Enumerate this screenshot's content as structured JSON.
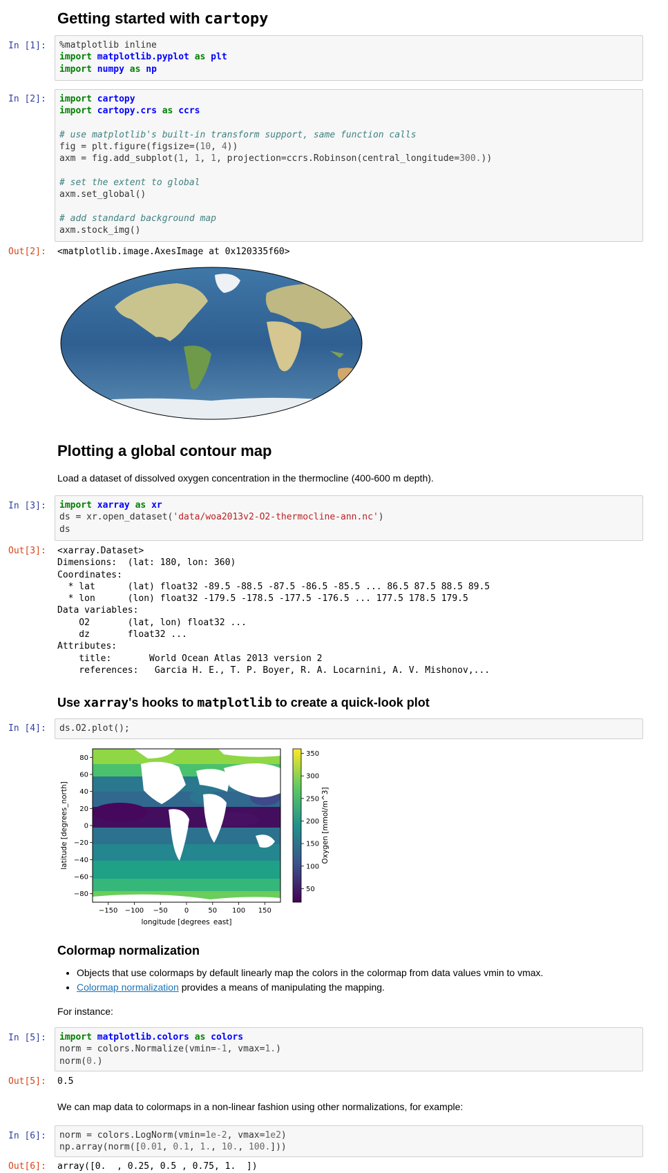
{
  "cells": {
    "h_start": {
      "pre": "Getting started with ",
      "code": "cartopy"
    },
    "c1": {
      "prompt": "In [1]:"
    },
    "c2": {
      "prompt": "In [2]:",
      "out_prompt": "Out[2]:",
      "out": "<matplotlib.image.AxesImage at 0x120335f60>"
    },
    "h_contour": "Plotting a global contour map",
    "p_contour": "Load a dataset of dissolved oxygen concentration in the thermocline (400-600 m depth).",
    "c3": {
      "prompt": "In [3]:",
      "out_prompt": "Out[3]:"
    },
    "h_hooks": {
      "pre": "Use ",
      "code1": "xarray",
      "mid": "'s hooks to ",
      "code2": "matplotlib",
      "post": " to create a quick-look plot"
    },
    "c4": {
      "prompt": "In [4]:"
    },
    "h_norm": "Colormap normalization",
    "bullets": {
      "b1": "Objects that use colormaps by default linearly map the colors in the colormap from data values vmin to vmax.",
      "b2_link": "Colormap normalization",
      "b2_rest": " provides a means of manipulating the mapping."
    },
    "p_instance": "For instance:",
    "c5": {
      "prompt": "In [5]:",
      "out_prompt": "Out[5]:",
      "out": "0.5"
    },
    "p_nonlinear": "We can map data to colormaps in a non-linear fashion using other normalizations, for example:",
    "c6": {
      "prompt": "In [6]:",
      "out_prompt": "Out[6]:",
      "out": "array([0.  , 0.25, 0.5 , 0.75, 1.  ])"
    }
  },
  "code": {
    "c1": [
      "%matplotlib inline",
      "import matplotlib.pyplot as plt",
      "import numpy as np"
    ],
    "c2": [
      "import cartopy",
      "import cartopy.crs as ccrs",
      "",
      "# use matplotlib's built-in transform support, same function calls",
      "fig = plt.figure(figsize=(10, 4))",
      "axm = fig.add_subplot(1, 1, 1, projection=ccrs.Robinson(central_longitude=300.))",
      "",
      "# set the extent to global",
      "axm.set_global()",
      "",
      "# add standard background map",
      "axm.stock_img()"
    ],
    "c3": [
      "import xarray as xr",
      "ds = xr.open_dataset('data/woa2013v2-O2-thermocline-ann.nc')",
      "ds"
    ],
    "c4": [
      "ds.O2.plot();"
    ],
    "c5": [
      "import matplotlib.colors as colors",
      "norm = colors.Normalize(vmin=-1, vmax=1.)",
      "norm(0.)"
    ],
    "c6": [
      "norm = colors.LogNorm(vmin=1e-2, vmax=1e2)",
      "np.array(norm([0.01, 0.1, 1., 10., 100.]))"
    ]
  },
  "dataset_repr": [
    "<xarray.Dataset>",
    "Dimensions:  (lat: 180, lon: 360)",
    "Coordinates:",
    "  * lat      (lat) float32 -89.5 -88.5 -87.5 -86.5 -85.5 ... 86.5 87.5 88.5 89.5",
    "  * lon      (lon) float32 -179.5 -178.5 -177.5 -176.5 ... 177.5 178.5 179.5",
    "Data variables:",
    "    O2       (lat, lon) float32 ...",
    "    dz       float32 ...",
    "Attributes:",
    "    title:       World Ocean Atlas 2013 version 2",
    "    references:   Garcia H. E., T. P. Boyer, R. A. Locarnini, A. V. Mishonov,..."
  ],
  "chart_data": [
    {
      "type": "heatmap",
      "description_free": true,
      "xlabel": "longitude [degrees_east]",
      "ylabel": "latitude [degrees_north]",
      "colorbar_label": "Oxygen [mmol/m^3]",
      "xlim": [
        -180,
        180
      ],
      "ylim": [
        -90,
        90
      ],
      "x_ticks": [
        -150,
        -100,
        -50,
        0,
        50,
        100,
        150
      ],
      "y_ticks": [
        80,
        60,
        40,
        20,
        0,
        -20,
        -40,
        -60,
        -80
      ],
      "colorbar_ticks": [
        50,
        100,
        150,
        200,
        250,
        300,
        350
      ],
      "clim": [
        20,
        360
      ],
      "colormap": [
        "#440154",
        "#3b528b",
        "#21918c",
        "#5ec962",
        "#fde725"
      ]
    }
  ],
  "tick_labels": {
    "x": [
      "−150",
      "−100",
      "−50",
      "0",
      "50",
      "100",
      "150"
    ],
    "y": [
      "80",
      "60",
      "40",
      "20",
      "0",
      "−20",
      "−40",
      "−60",
      "−80"
    ],
    "cb": [
      "50",
      "100",
      "150",
      "200",
      "250",
      "300",
      "350"
    ]
  },
  "colors": {
    "prompt_in": "#303f9f",
    "prompt_out": "#d84315",
    "link": "#1a73b8"
  }
}
